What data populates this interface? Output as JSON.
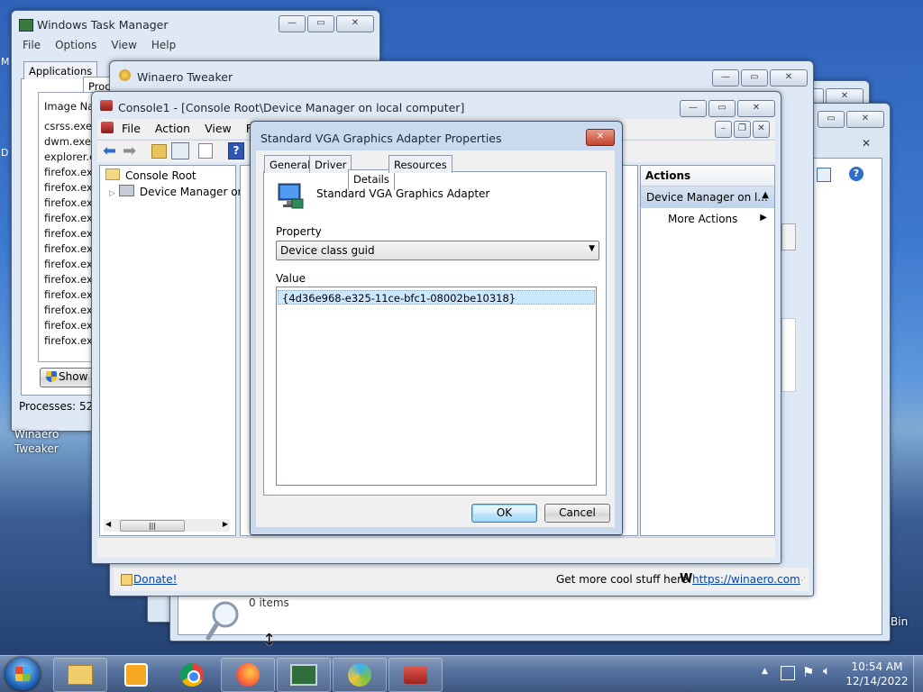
{
  "desktop": {
    "icon_label": "Winaero\nTweaker",
    "recycle_bin_label": "Bin",
    "left_edge_letters": [
      "M",
      "D"
    ]
  },
  "task_manager": {
    "title": "Windows Task Manager",
    "menu": [
      "File",
      "Options",
      "View",
      "Help"
    ],
    "tabs": [
      "Applications",
      "Proc"
    ],
    "column_header": "Image Nam",
    "processes": [
      "csrss.exe",
      "dwm.exe",
      "explorer.ex",
      "firefox.exe",
      "firefox.exe",
      "firefox.exe",
      "firefox.exe",
      "firefox.exe",
      "firefox.exe",
      "firefox.exe",
      "firefox.exe",
      "firefox.exe",
      "firefox.exe",
      "firefox.exe",
      "firefox.exe"
    ],
    "show_button": "Show p",
    "status": "Processes: 52"
  },
  "winaero": {
    "title": "Winaero Tweaker",
    "donate_link": "Donate!",
    "more_text": "Get more cool stuff here:",
    "url_link": "https://winaero.com",
    "w_glyph": "W"
  },
  "explorer_back": {
    "items_text": "0 items"
  },
  "console": {
    "title": "Console1 - [Console Root\\Device Manager on local computer]",
    "menu": [
      "File",
      "Action",
      "View",
      "Fav"
    ],
    "tree": {
      "root": "Console Root",
      "child": "Device Manager on"
    },
    "actions_header": "Actions",
    "actions_item": "Device Manager on l...",
    "more_actions": "More Actions"
  },
  "dialog": {
    "title": "Standard VGA Graphics Adapter Properties",
    "tabs": [
      "General",
      "Driver",
      "Details",
      "Resources"
    ],
    "device_name": "Standard VGA Graphics Adapter",
    "property_label": "Property",
    "property_value": "Device class guid",
    "value_label": "Value",
    "value_item": "{4d36e968-e325-11ce-bfc1-08002be10318}",
    "ok": "OK",
    "cancel": "Cancel"
  },
  "tray": {
    "time": "10:54 AM",
    "date": "12/14/2022"
  },
  "colors": {
    "selection": "#cce8ff",
    "title_text": "#1d2733",
    "link": "#0645ad"
  }
}
